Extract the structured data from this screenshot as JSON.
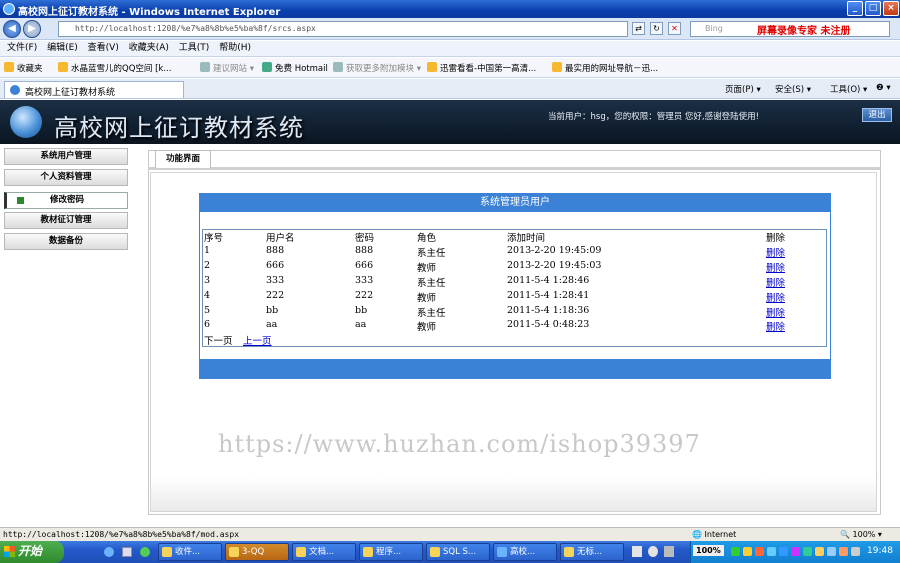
{
  "window": {
    "title": "高校网上征订教材系统 - Windows Internet Explorer",
    "controls": [
      "_",
      "□",
      "×"
    ]
  },
  "browser": {
    "address": "http://localhost:1208/%e7%a8%8b%e5%ba%8f/srcs.aspx",
    "recorder_text": "屏幕录像专家 未注册",
    "search_placeholder": "Bing",
    "menu": [
      "文件(F)",
      "编辑(E)",
      "查看(V)",
      "收藏夹(A)",
      "工具(T)",
      "帮助(H)"
    ],
    "favorites_label": "收藏夹",
    "favorites": [
      "水晶蓝雪儿的QQ空间 [k...",
      "建议网站 ▾",
      "免费 Hotmail",
      "获取更多附加模块 ▾",
      "迅雷看看-中国第一高清...",
      "最实用的网址导航－迅..."
    ],
    "tab_title": "高校网上征订教材系统",
    "toolbar": [
      "页面(P) ▾",
      "安全(S) ▾",
      "工具(O) ▾",
      "❷ ▾"
    ]
  },
  "site": {
    "title": "高校网上征订教材系统",
    "user_info": "当前用户：hsg，您的权限：管理员 您好,感谢登陆使用!",
    "logout_label": "退出"
  },
  "sidebar": {
    "items": [
      {
        "label": "系统用户管理"
      },
      {
        "label": "个人资料管理"
      },
      {
        "label": "修改密码"
      },
      {
        "label": "教材征订管理"
      },
      {
        "label": "数据备份"
      }
    ]
  },
  "content": {
    "tab_label": "功能界面",
    "panel_title": "系统管理员用户",
    "table": {
      "headers": [
        "序号",
        "用户名",
        "密码",
        "角色",
        "添加时间",
        "删除"
      ],
      "rows": [
        [
          "1",
          "888",
          "888",
          "系主任",
          "2013-2-20 19:45:09",
          "删除"
        ],
        [
          "2",
          "666",
          "666",
          "教师",
          "2013-2-20 19:45:03",
          "删除"
        ],
        [
          "3",
          "333",
          "333",
          "系主任",
          "2011-5-4 1:28:46",
          "删除"
        ],
        [
          "4",
          "222",
          "222",
          "教师",
          "2011-5-4 1:28:41",
          "删除"
        ],
        [
          "5",
          "bb",
          "bb",
          "系主任",
          "2011-5-4 1:18:36",
          "删除"
        ],
        [
          "6",
          "aa",
          "aa",
          "教师",
          "2011-5-4 0:48:23",
          "删除"
        ]
      ]
    },
    "pager": {
      "next": "下一页",
      "prev": "上一页"
    }
  },
  "watermark": "https://www.huzhan.com/ishop39397",
  "statusbar": {
    "url": "http://localhost:1208/%e7%a8%8b%e5%ba%8f/mod.aspx",
    "zone": "Internet",
    "zoom": "100%"
  },
  "taskbar": {
    "start_label": "开始",
    "tasks": [
      "收件...",
      "3-QQ",
      "文档...",
      "程序...",
      "SQL S...",
      "高校...",
      "无标..."
    ],
    "tray_percent": "100%",
    "clock": "19:48"
  },
  "colors": {
    "panel_blue": "#3b82d6",
    "header_dark": "#0f1d2d",
    "link_blue": "#0000cc"
  }
}
